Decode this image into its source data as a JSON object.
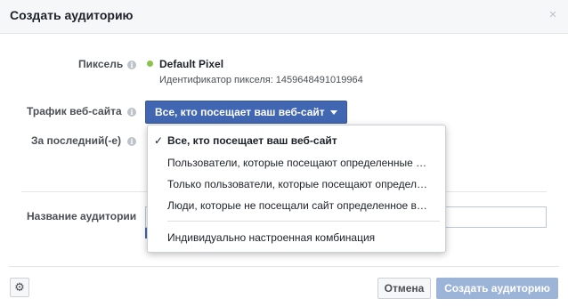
{
  "dialog": {
    "title": "Создать аудиторию",
    "close_symbol": "×"
  },
  "pixel": {
    "label": "Пиксель",
    "name": "Default Pixel",
    "id_text": "Идентификатор пикселя: 1459648491019964",
    "status_color": "#8bc34a"
  },
  "traffic": {
    "label": "Трафик веб-сайта",
    "selected": "Все, кто посещает ваш веб-сайт"
  },
  "period": {
    "label": "За последний(-е)"
  },
  "audience": {
    "label": "Название аудитории",
    "value": ""
  },
  "dropdown": {
    "items": [
      "Все, кто посещает ваш веб-сайт",
      "Пользователи, которые посещают определенные …",
      "Только пользователи, которые посещают определ…",
      "Люди, которые не посещали сайт определенное в…",
      "Индивидуально настроенная комбинация"
    ],
    "check": "✓"
  },
  "footer": {
    "cancel_label": "Отмена",
    "create_label": "Создать аудиторию",
    "accent_color": "#4267b2"
  },
  "icons": {
    "info": "i",
    "gear": "⚙"
  }
}
